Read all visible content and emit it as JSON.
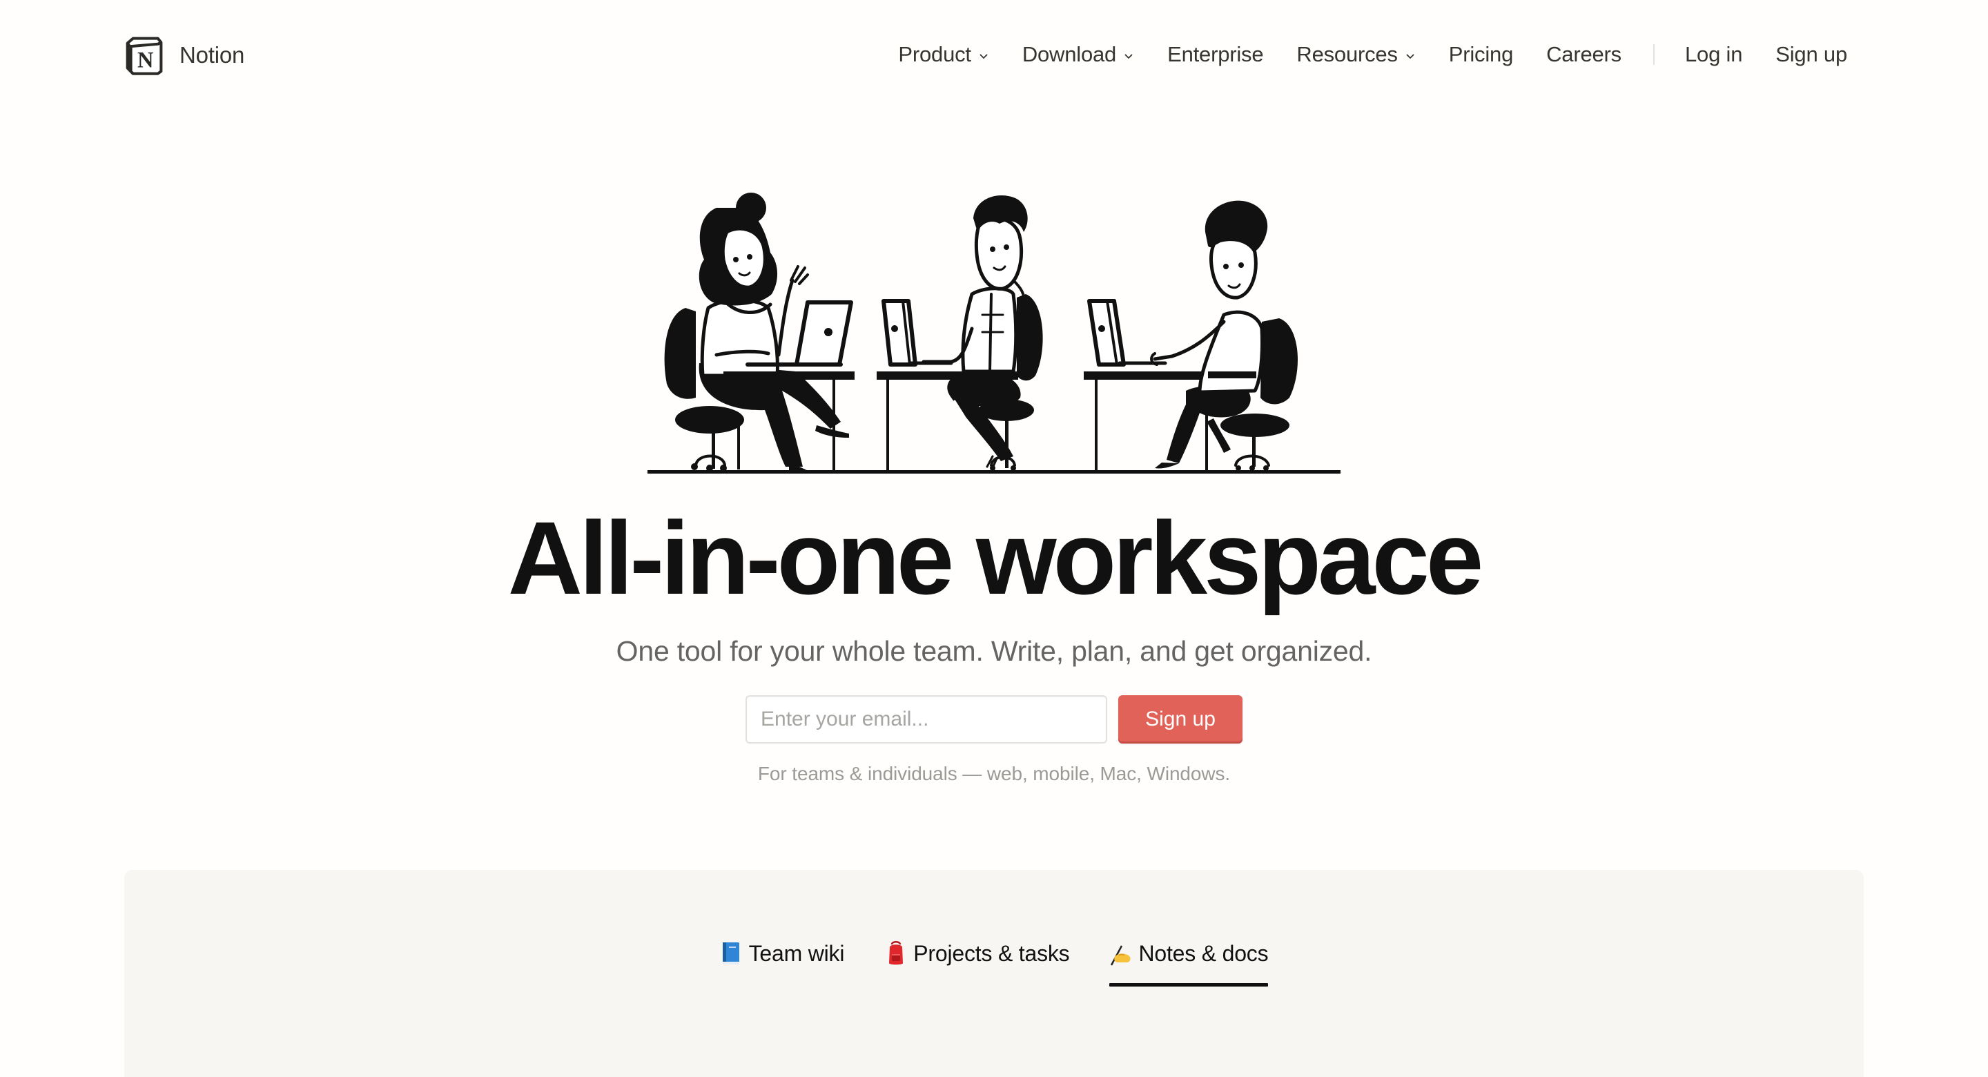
{
  "nav": {
    "brand": "Notion",
    "brand_icon": "notion-logo-icon",
    "items": [
      {
        "label": "Product",
        "has_dropdown": true
      },
      {
        "label": "Download",
        "has_dropdown": true
      },
      {
        "label": "Enterprise",
        "has_dropdown": false
      },
      {
        "label": "Resources",
        "has_dropdown": true
      },
      {
        "label": "Pricing",
        "has_dropdown": false
      },
      {
        "label": "Careers",
        "has_dropdown": false
      }
    ],
    "login_label": "Log in",
    "signup_label": "Sign up"
  },
  "hero": {
    "illustration": "three-people-working-at-laptops",
    "headline": "All-in-one workspace",
    "subtitle": "One tool for your whole team. Write, plan, and get organized.",
    "email_placeholder": "Enter your email...",
    "email_value": "",
    "signup_button": "Sign up",
    "footnote": "For teams & individuals — web, mobile, Mac, Windows."
  },
  "features": {
    "tabs": [
      {
        "icon": "blue-book-icon",
        "label": "Team wiki",
        "active": false
      },
      {
        "icon": "backpack-icon",
        "label": "Projects & tasks",
        "active": false
      },
      {
        "icon": "writing-hand-icon",
        "label": "Notes & docs",
        "active": true
      }
    ]
  },
  "colors": {
    "background": "#fffefc",
    "text": "#37352f",
    "headline": "#111111",
    "accent": "#e16259",
    "panel": "#f7f6f3"
  }
}
